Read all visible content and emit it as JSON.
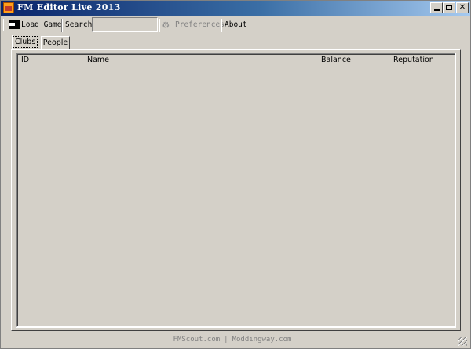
{
  "window": {
    "title": "FM Editor Live 2013"
  },
  "toolbar": {
    "load_game_label": "Load Game",
    "search_label": "Search",
    "search_value": "",
    "preferences_label": "Preferences",
    "about_label": "About"
  },
  "tabs": [
    {
      "label": "Clubs",
      "selected": true
    },
    {
      "label": "People",
      "selected": false
    }
  ],
  "table": {
    "columns": [
      "ID",
      "Name",
      "Balance",
      "Reputation"
    ],
    "rows": []
  },
  "status": {
    "link1": "FMScout.com",
    "separator": "|",
    "link2": "Moddingway.com"
  },
  "icons": {
    "app": "fm-editor-app-icon",
    "load": "folder-open-icon",
    "preferences": "gear-icon"
  }
}
